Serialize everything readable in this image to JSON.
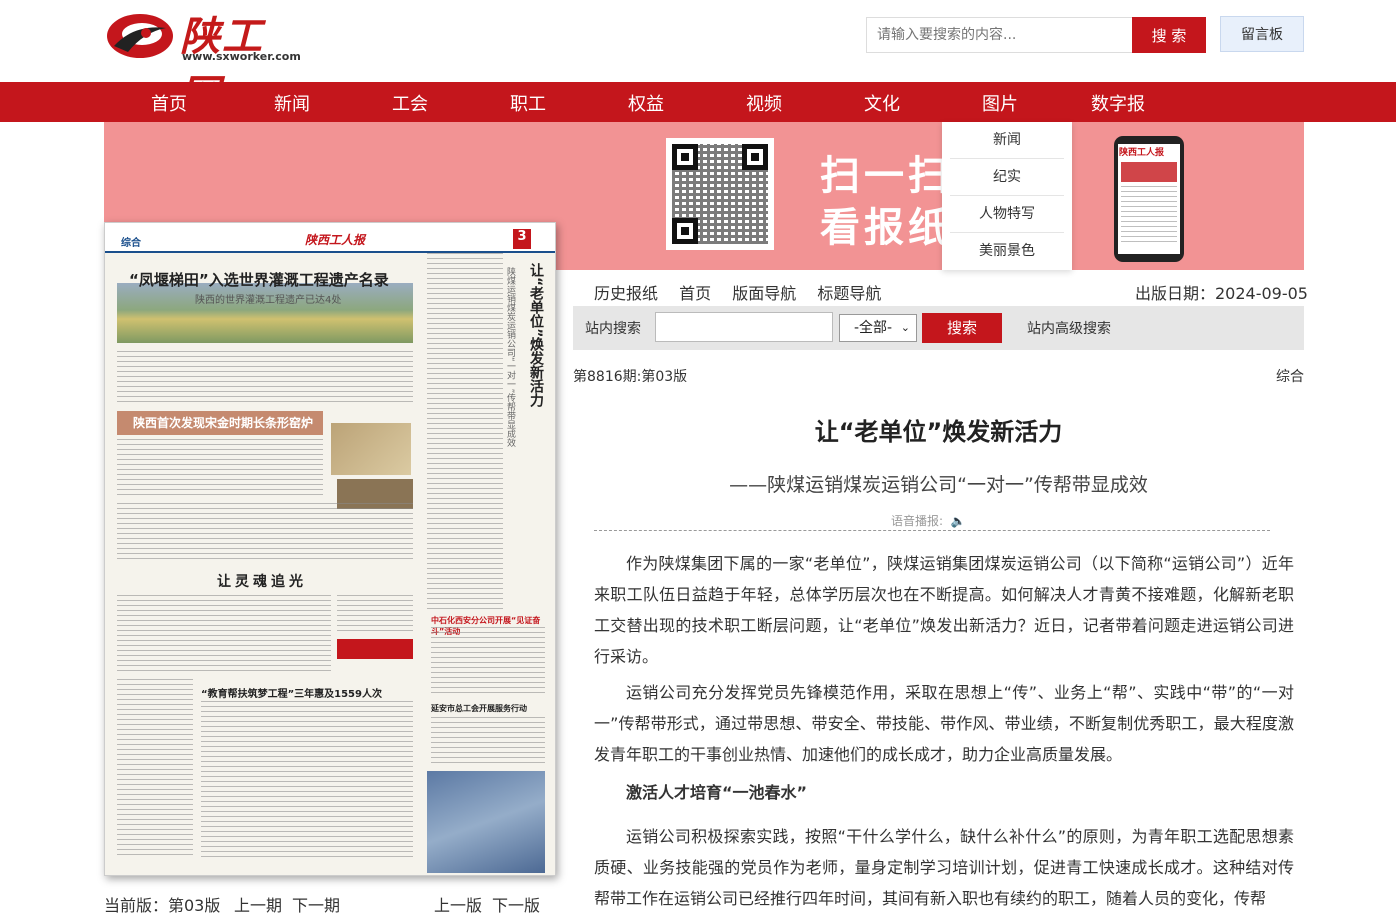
{
  "header": {
    "logo_text": "陕工网",
    "logo_url": "www.sxworker.com",
    "search_placeholder": "请输入要搜索的内容...",
    "search_button": "搜 索",
    "message_button": "留言板"
  },
  "nav": {
    "items": [
      "首页",
      "新闻",
      "工会",
      "职工",
      "权益",
      "视频",
      "文化",
      "图片",
      "数字报"
    ],
    "dropdown": [
      "新闻",
      "纪实",
      "人物特写",
      "美丽景色"
    ]
  },
  "banner": {
    "line1": "扫一扫",
    "line2": "看报纸",
    "phone_title": "陕西工人报"
  },
  "paper": {
    "section": "综合",
    "masthead": "陕西工人报",
    "page_num": "3",
    "headline1": "“凤堰梯田”入选世界灌溉工程遗产名录",
    "sub1": "陕西的世界灌溉工程遗产已达4处",
    "headline2": "陕西首次发现宋金时期长条形窑炉",
    "vertical_headline": "让“老单位”焕发新活力",
    "vertical_sub": "陕煤运销煤炭运销公司“一对一”传帮带显成效",
    "headline3": "让灵魂追光",
    "headline4": "“教育帮扶筑梦工程”三年惠及1559人次",
    "headline5": "中石化西安分公司开展“见证奋斗”活动",
    "headline6": "延安市总工会开展服务行动"
  },
  "pager": {
    "current": "当前版：第03版",
    "prev_issue": "上一期",
    "next_issue": "下一期",
    "prev_page": "上一版",
    "next_page": "下一版"
  },
  "right": {
    "nav": [
      "历史报纸",
      "首页",
      "版面导航",
      "标题导航"
    ],
    "pubdate": "出版日期：2024-09-05",
    "search_label": "站内搜索",
    "select_value": "-全部-",
    "search_button": "搜索",
    "advanced": "站内高级搜索",
    "issue": "第8816期:第03版",
    "section": "综合"
  },
  "article": {
    "title": "让“老单位”焕发新活力",
    "subtitle": "——陕煤运销煤炭运销公司“一对一”传帮带显成效",
    "speech": "语音播报:",
    "paragraphs": [
      "作为陕煤集团下属的一家“老单位”，陕煤运销集团煤炭运销公司（以下简称“运销公司”）近年来职工队伍日益趋于年轻，总体学历层次也在不断提高。如何解决人才青黄不接难题，化解新老职工交替出现的技术职工断层问题，让“老单位”焕发出新活力？近日，记者带着问题走进运销公司进行采访。",
      "运销公司充分发挥党员先锋模范作用，采取在思想上“传”、业务上“帮”、实践中“带”的“一对一”传帮带形式，通过带思想、带安全、带技能、带作风、带业绩，不断复制优秀职工，最大程度激发青年职工的干事创业热情、加速他们的成长成才，助力企业高质量发展。"
    ],
    "subhead": "激活人才培育“一池春水”",
    "paragraph3": "运销公司积极探索实践，按照“干什么学什么，缺什么补什么”的原则，为青年职工选配思想素质硬、业务技能强的党员作为老师，量身定制学习培训计划，促进青工快速成长成才。这种结对传帮带工作在运销公司已经推行四年时间，其间有新入职也有续约的职工，随着人员的变化，传帮"
  }
}
